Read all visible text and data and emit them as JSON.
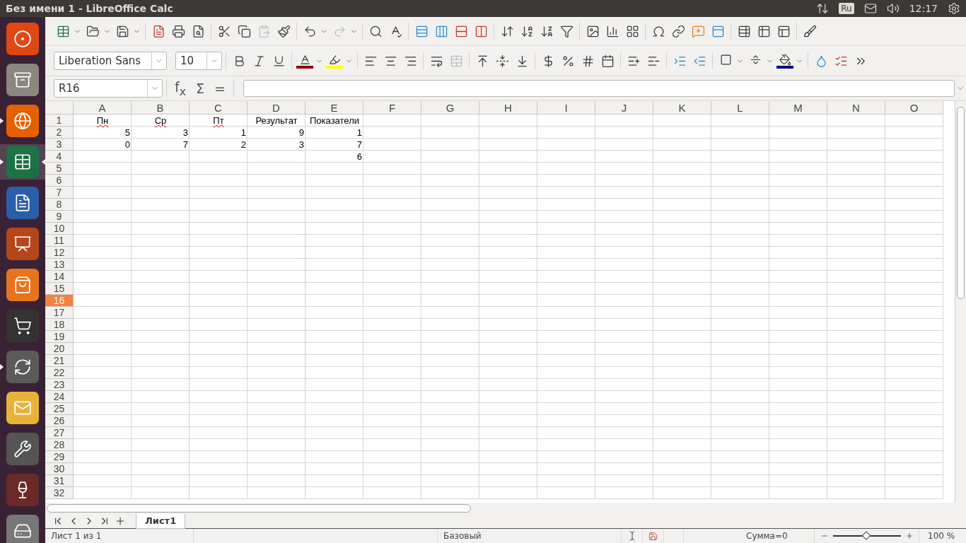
{
  "top_bar": {
    "title": "Без имени 1 - LibreOffice Calc",
    "keyboard_layout": "Ru",
    "clock": "12:17"
  },
  "launcher": [
    {
      "kind": "ubuntu",
      "running": false,
      "focused": false
    },
    {
      "kind": "files",
      "running": false,
      "focused": false
    },
    {
      "kind": "firefox",
      "running": true,
      "focused": false
    },
    {
      "kind": "calc",
      "running": true,
      "focused": true
    },
    {
      "kind": "writer",
      "running": false,
      "focused": false
    },
    {
      "kind": "impress",
      "running": false,
      "focused": false
    },
    {
      "kind": "software",
      "running": false,
      "focused": false
    },
    {
      "kind": "amazon",
      "running": false,
      "focused": false
    },
    {
      "kind": "updater",
      "running": true,
      "focused": false
    },
    {
      "kind": "mail",
      "running": false,
      "focused": false
    },
    {
      "kind": "settings",
      "running": false,
      "focused": false
    },
    {
      "kind": "wine",
      "running": false,
      "focused": false
    },
    {
      "kind": "drive",
      "running": false,
      "focused": false
    }
  ],
  "formatting": {
    "font_name": "Liberation Sans",
    "font_size": "10"
  },
  "formula_bar": {
    "name_box": "R16",
    "buttons": [
      "f$_{x}$",
      "Σ",
      "="
    ]
  },
  "columns": [
    "A",
    "B",
    "C",
    "D",
    "E",
    "F",
    "G",
    "H",
    "I",
    "J",
    "K",
    "L",
    "M",
    "N",
    "O"
  ],
  "rows": [
    {
      "label": "1",
      "selected": false,
      "cells": [
        {
          "text": "Пн",
          "kind": "text",
          "misspelled": true
        },
        {
          "text": "Ср",
          "kind": "text",
          "misspelled": true
        },
        {
          "text": "Пт",
          "kind": "text",
          "misspelled": true
        },
        {
          "text": "Результат",
          "kind": "text",
          "misspelled": false
        },
        {
          "text": "Показатели",
          "kind": "text",
          "misspelled": false
        }
      ]
    },
    {
      "label": "2",
      "selected": false,
      "cells": [
        {
          "text": "5",
          "kind": "number",
          "misspelled": false
        },
        {
          "text": "3",
          "kind": "number",
          "misspelled": false
        },
        {
          "text": "1",
          "kind": "number",
          "misspelled": false
        },
        {
          "text": "9",
          "kind": "number",
          "misspelled": false
        },
        {
          "text": "1",
          "kind": "number",
          "misspelled": false
        }
      ]
    },
    {
      "label": "3",
      "selected": false,
      "cells": [
        {
          "text": "0",
          "kind": "number",
          "misspelled": false
        },
        {
          "text": "7",
          "kind": "number",
          "misspelled": false
        },
        {
          "text": "2",
          "kind": "number",
          "misspelled": false
        },
        {
          "text": "3",
          "kind": "number",
          "misspelled": false
        },
        {
          "text": "7",
          "kind": "number",
          "misspelled": false
        }
      ]
    },
    {
      "label": "4",
      "selected": false,
      "cells": [
        null,
        null,
        null,
        null,
        {
          "text": "6",
          "kind": "number",
          "misspelled": false
        }
      ]
    },
    {
      "label": "5",
      "selected": false
    },
    {
      "label": "6",
      "selected": false
    },
    {
      "label": "7",
      "selected": false
    },
    {
      "label": "8",
      "selected": false
    },
    {
      "label": "9",
      "selected": false
    },
    {
      "label": "10",
      "selected": false
    },
    {
      "label": "11",
      "selected": false
    },
    {
      "label": "12",
      "selected": false
    },
    {
      "label": "13",
      "selected": false
    },
    {
      "label": "14",
      "selected": false
    },
    {
      "label": "15",
      "selected": false
    },
    {
      "label": "16",
      "selected": true
    },
    {
      "label": "17",
      "selected": false
    },
    {
      "label": "18",
      "selected": false
    },
    {
      "label": "19",
      "selected": false
    },
    {
      "label": "20",
      "selected": false
    },
    {
      "label": "21",
      "selected": false
    },
    {
      "label": "22",
      "selected": false
    },
    {
      "label": "23",
      "selected": false
    },
    {
      "label": "24",
      "selected": false
    },
    {
      "label": "25",
      "selected": false
    },
    {
      "label": "26",
      "selected": false
    },
    {
      "label": "27",
      "selected": false
    },
    {
      "label": "28",
      "selected": false
    },
    {
      "label": "29",
      "selected": false
    },
    {
      "label": "30",
      "selected": false
    },
    {
      "label": "31",
      "selected": false
    },
    {
      "label": "32",
      "selected": false
    }
  ],
  "sheet_tabs": [
    {
      "label": "Лист1",
      "selected": true
    }
  ],
  "status_bar": {
    "sheet": "Лист 1 из 1",
    "style": "Базовый",
    "sum": "Сумма=0",
    "zoom": {
      "level": 0.49,
      "reading": "100 %"
    }
  }
}
